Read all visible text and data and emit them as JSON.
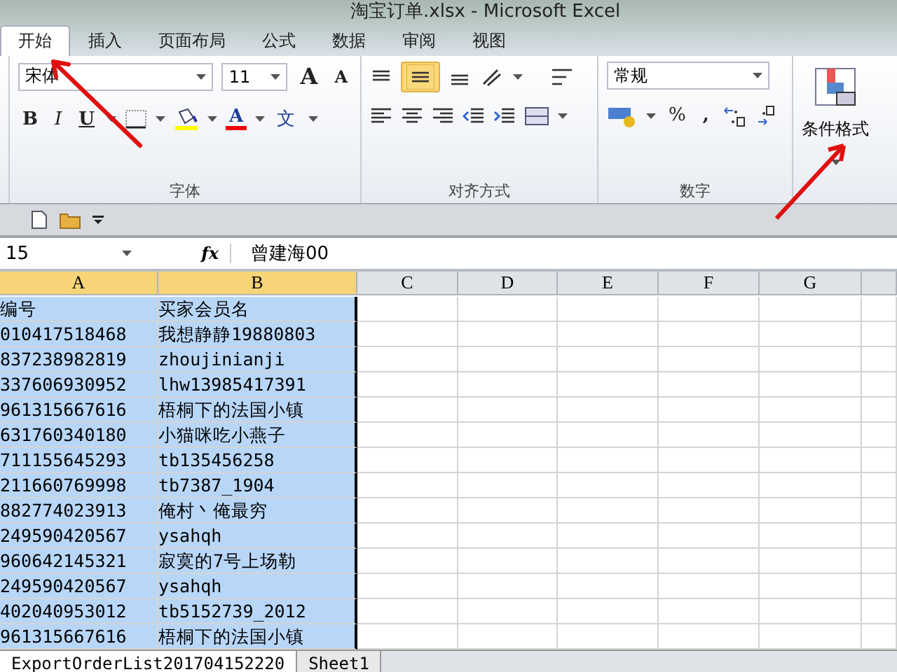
{
  "window": {
    "title": "淘宝订单.xlsx  -  Microsoft Excel"
  },
  "tabs": [
    {
      "label": "开始",
      "selected": true
    },
    {
      "label": "插入",
      "selected": false
    },
    {
      "label": "页面布局",
      "selected": false
    },
    {
      "label": "公式",
      "selected": false
    },
    {
      "label": "数据",
      "selected": false
    },
    {
      "label": "审阅",
      "selected": false
    },
    {
      "label": "视图",
      "selected": false
    }
  ],
  "ribbon": {
    "font": {
      "name": "宋体",
      "size": "11",
      "grow": "A",
      "shrink": "A",
      "bold": "B",
      "italic": "I",
      "underline": "U",
      "font_color": "A",
      "phonetic": "文",
      "group_label": "字体"
    },
    "alignment": {
      "group_label": "对齐方式"
    },
    "number": {
      "format": "常规",
      "percent": "%",
      "comma": ",",
      "group_label": "数字"
    },
    "styles": {
      "conditional_format": "条件格式"
    }
  },
  "name_box": "15",
  "fx": "fx",
  "formula": "曾建海00",
  "columns": [
    {
      "label": "A",
      "selected": true
    },
    {
      "label": "B",
      "selected": true
    },
    {
      "label": "C",
      "selected": false
    },
    {
      "label": "D",
      "selected": false
    },
    {
      "label": "E",
      "selected": false
    },
    {
      "label": "F",
      "selected": false
    },
    {
      "label": "G",
      "selected": false
    }
  ],
  "rows": [
    [
      "编号",
      "买家会员名"
    ],
    [
      "010417518468",
      "我想静静19880803"
    ],
    [
      "837238982819",
      "zhoujinianji"
    ],
    [
      "337606930952",
      "lhw13985417391"
    ],
    [
      "961315667616",
      "梧桐下的法国小镇"
    ],
    [
      "631760340180",
      "小猫咪吃小燕子"
    ],
    [
      "711155645293",
      "tb135456258"
    ],
    [
      "211660769998",
      "tb7387_1904"
    ],
    [
      "882774023913",
      "俺村丶俺最穷"
    ],
    [
      "249590420567",
      "ysahqh"
    ],
    [
      "960642145321",
      "寂寞的7号上场勒"
    ],
    [
      "249590420567",
      "ysahqh"
    ],
    [
      "402040953012",
      "tb5152739_2012"
    ],
    [
      "961315667616",
      "梧桐下的法国小镇"
    ]
  ],
  "sheet_tabs": [
    {
      "label": "ExportOrderList201704152220",
      "selected": true
    },
    {
      "label": "Sheet1",
      "selected": false
    }
  ]
}
